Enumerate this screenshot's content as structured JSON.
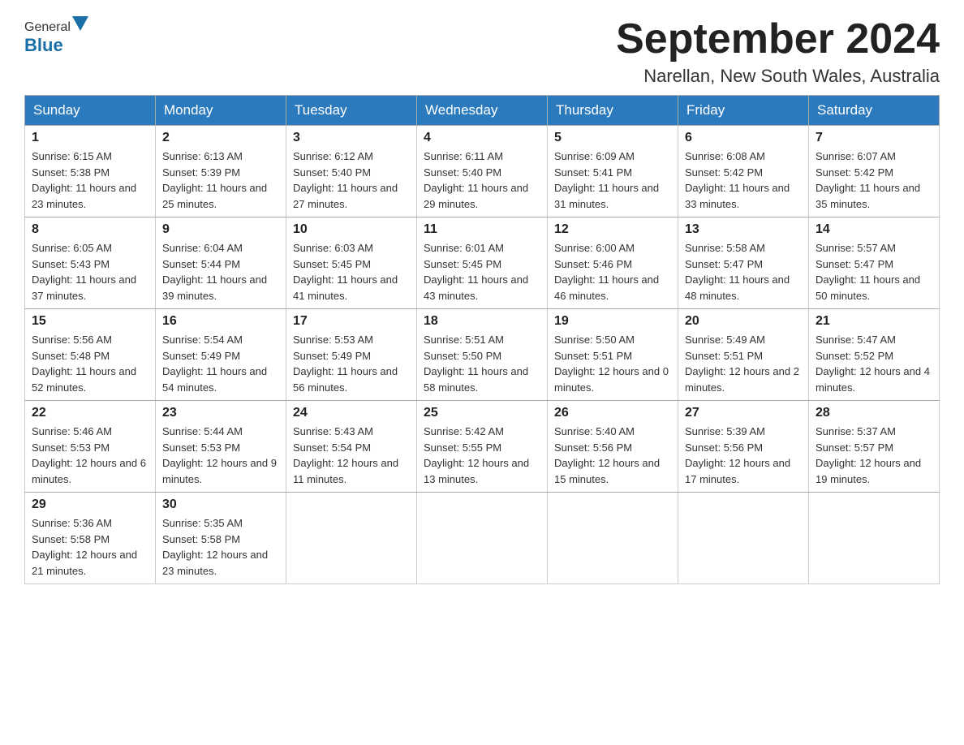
{
  "header": {
    "logo_general": "General",
    "logo_blue": "Blue",
    "month_title": "September 2024",
    "location": "Narellan, New South Wales, Australia"
  },
  "days_of_week": [
    "Sunday",
    "Monday",
    "Tuesday",
    "Wednesday",
    "Thursday",
    "Friday",
    "Saturday"
  ],
  "weeks": [
    [
      {
        "day": "1",
        "sunrise": "6:15 AM",
        "sunset": "5:38 PM",
        "daylight": "11 hours and 23 minutes."
      },
      {
        "day": "2",
        "sunrise": "6:13 AM",
        "sunset": "5:39 PM",
        "daylight": "11 hours and 25 minutes."
      },
      {
        "day": "3",
        "sunrise": "6:12 AM",
        "sunset": "5:40 PM",
        "daylight": "11 hours and 27 minutes."
      },
      {
        "day": "4",
        "sunrise": "6:11 AM",
        "sunset": "5:40 PM",
        "daylight": "11 hours and 29 minutes."
      },
      {
        "day": "5",
        "sunrise": "6:09 AM",
        "sunset": "5:41 PM",
        "daylight": "11 hours and 31 minutes."
      },
      {
        "day": "6",
        "sunrise": "6:08 AM",
        "sunset": "5:42 PM",
        "daylight": "11 hours and 33 minutes."
      },
      {
        "day": "7",
        "sunrise": "6:07 AM",
        "sunset": "5:42 PM",
        "daylight": "11 hours and 35 minutes."
      }
    ],
    [
      {
        "day": "8",
        "sunrise": "6:05 AM",
        "sunset": "5:43 PM",
        "daylight": "11 hours and 37 minutes."
      },
      {
        "day": "9",
        "sunrise": "6:04 AM",
        "sunset": "5:44 PM",
        "daylight": "11 hours and 39 minutes."
      },
      {
        "day": "10",
        "sunrise": "6:03 AM",
        "sunset": "5:45 PM",
        "daylight": "11 hours and 41 minutes."
      },
      {
        "day": "11",
        "sunrise": "6:01 AM",
        "sunset": "5:45 PM",
        "daylight": "11 hours and 43 minutes."
      },
      {
        "day": "12",
        "sunrise": "6:00 AM",
        "sunset": "5:46 PM",
        "daylight": "11 hours and 46 minutes."
      },
      {
        "day": "13",
        "sunrise": "5:58 AM",
        "sunset": "5:47 PM",
        "daylight": "11 hours and 48 minutes."
      },
      {
        "day": "14",
        "sunrise": "5:57 AM",
        "sunset": "5:47 PM",
        "daylight": "11 hours and 50 minutes."
      }
    ],
    [
      {
        "day": "15",
        "sunrise": "5:56 AM",
        "sunset": "5:48 PM",
        "daylight": "11 hours and 52 minutes."
      },
      {
        "day": "16",
        "sunrise": "5:54 AM",
        "sunset": "5:49 PM",
        "daylight": "11 hours and 54 minutes."
      },
      {
        "day": "17",
        "sunrise": "5:53 AM",
        "sunset": "5:49 PM",
        "daylight": "11 hours and 56 minutes."
      },
      {
        "day": "18",
        "sunrise": "5:51 AM",
        "sunset": "5:50 PM",
        "daylight": "11 hours and 58 minutes."
      },
      {
        "day": "19",
        "sunrise": "5:50 AM",
        "sunset": "5:51 PM",
        "daylight": "12 hours and 0 minutes."
      },
      {
        "day": "20",
        "sunrise": "5:49 AM",
        "sunset": "5:51 PM",
        "daylight": "12 hours and 2 minutes."
      },
      {
        "day": "21",
        "sunrise": "5:47 AM",
        "sunset": "5:52 PM",
        "daylight": "12 hours and 4 minutes."
      }
    ],
    [
      {
        "day": "22",
        "sunrise": "5:46 AM",
        "sunset": "5:53 PM",
        "daylight": "12 hours and 6 minutes."
      },
      {
        "day": "23",
        "sunrise": "5:44 AM",
        "sunset": "5:53 PM",
        "daylight": "12 hours and 9 minutes."
      },
      {
        "day": "24",
        "sunrise": "5:43 AM",
        "sunset": "5:54 PM",
        "daylight": "12 hours and 11 minutes."
      },
      {
        "day": "25",
        "sunrise": "5:42 AM",
        "sunset": "5:55 PM",
        "daylight": "12 hours and 13 minutes."
      },
      {
        "day": "26",
        "sunrise": "5:40 AM",
        "sunset": "5:56 PM",
        "daylight": "12 hours and 15 minutes."
      },
      {
        "day": "27",
        "sunrise": "5:39 AM",
        "sunset": "5:56 PM",
        "daylight": "12 hours and 17 minutes."
      },
      {
        "day": "28",
        "sunrise": "5:37 AM",
        "sunset": "5:57 PM",
        "daylight": "12 hours and 19 minutes."
      }
    ],
    [
      {
        "day": "29",
        "sunrise": "5:36 AM",
        "sunset": "5:58 PM",
        "daylight": "12 hours and 21 minutes."
      },
      {
        "day": "30",
        "sunrise": "5:35 AM",
        "sunset": "5:58 PM",
        "daylight": "12 hours and 23 minutes."
      },
      null,
      null,
      null,
      null,
      null
    ]
  ]
}
